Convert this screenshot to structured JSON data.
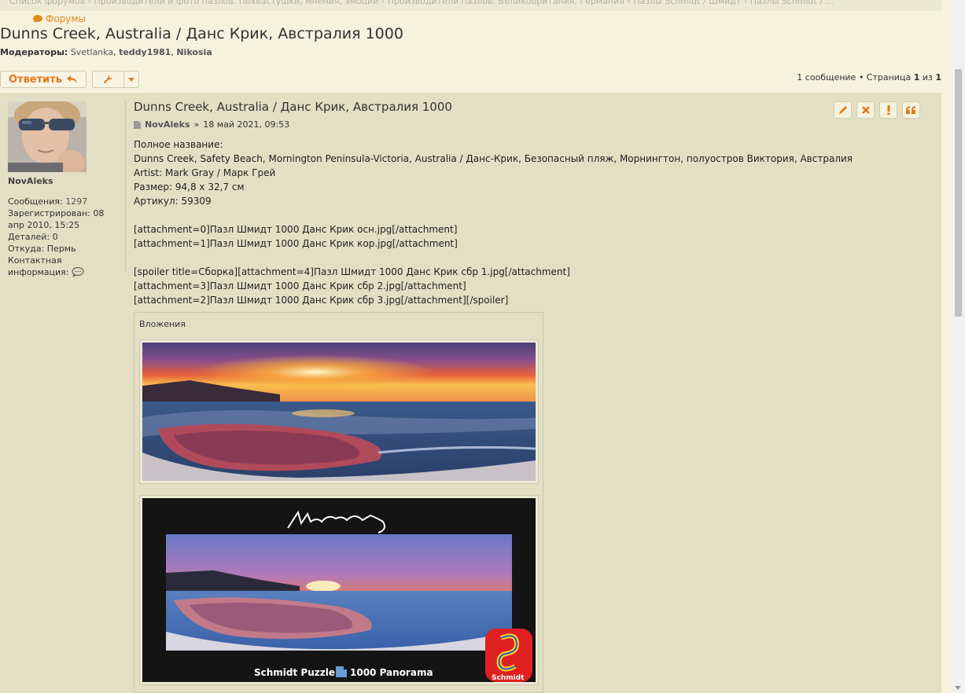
{
  "breadcrumbs": "Список форумов ‹ Производители и фото пазлов. Похвастушки, мнения, эмоции ‹ Производители пазлов. Великобритания, Германия ‹ Пазлы Schmidt / Шмидт ‹ Пазлы Schmidt / ...",
  "forums_link": "Форумы",
  "topic_title": "Dunns Creek, Australia / Данс Крик, Австралия 1000",
  "moderators": {
    "label": "Модераторы:",
    "names": [
      "Svetlanka",
      "teddy1981",
      "Nikosia"
    ]
  },
  "toolbar": {
    "reply_label": "Ответить",
    "reply_icon": "reply-arrow-icon",
    "tools_icon": "wrench-icon"
  },
  "pagination": {
    "count_text": "1 сообщение • Страница",
    "current": "1",
    "of": "из",
    "total": "1"
  },
  "profile": {
    "username": "NovAleks",
    "posts_label": "Сообщения:",
    "posts": "1297",
    "registered_label": "Зарегистрирован:",
    "registered": "08 апр 2010, 15:25",
    "details_label": "Деталей:",
    "details": "0",
    "location_label": "Откуда:",
    "location": "Пермь",
    "contact_label": "Контактная информация:"
  },
  "post": {
    "title": "Dunns Creek, Australia / Данс Крик, Австралия 1000",
    "author": "NovAleks",
    "separator": "»",
    "date": "18 май 2021, 09:53",
    "lines": [
      "Полное название:",
      "Dunns Creek, Safety Beach, Mornington Peninsula-Victoria, Australia / Данс-Крик, Безопасный пляж, Морнингтон, полуостров Виктория, Австралия",
      "Artist: Mark Gray / Марк Грей",
      "Размер: 94,8 х 32,7 см",
      "Артикул: 59309",
      "",
      "[attachment=0]Пазл Шмидт 1000 Данс Крик осн.jpg[/attachment]",
      "[attachment=1]Пазл Шмидт 1000 Данс Крик кор.jpg[/attachment]",
      "",
      "[spoiler title=Сборка][attachment=4]Пазл Шмидт 1000 Данс Крик сбр 1.jpg[/attachment]",
      "[attachment=3]Пазл Шмидт 1000 Данс Крик сбр 2.jpg[/attachment]",
      "[attachment=2]Пазл Шмидт 1000 Данс Крик сбр 3.jpg[/attachment][/spoiler]"
    ],
    "actions": [
      "edit-icon",
      "delete-icon",
      "report-icon",
      "quote-icon"
    ]
  },
  "attachments": {
    "title": "Вложения",
    "box_brand": "Schmidt Puzzle",
    "box_count": "1000 Panorama",
    "box_logo": "Schmidt",
    "box_signature": "Mark Gray"
  },
  "colors": {
    "accent": "#e0781a",
    "page_bg": "#f5f2de",
    "post_bg": "#e2dfc5"
  }
}
